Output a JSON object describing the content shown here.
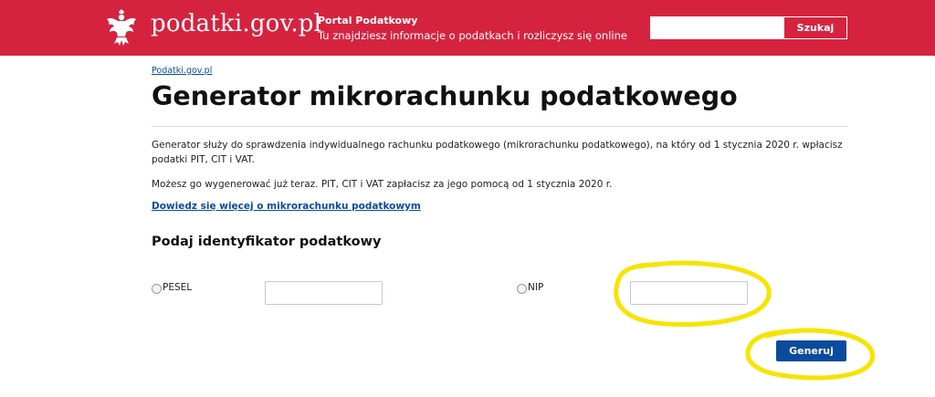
{
  "header": {
    "brand": "podatki.gov.pl",
    "portal_title": "Portal Podatkowy",
    "portal_subtitle": "Tu znajdziesz informacje o podatkach i rozliczysz się online",
    "search_value": "",
    "search_button": "Szukaj",
    "logo_icon": "white-eagle-emblem-icon"
  },
  "breadcrumb": "Podatki.gov.pl",
  "page_title": "Generator mikrorachunku podatkowego",
  "intro": {
    "paragraph1": "Generator służy do sprawdzenia indywidualnego rachunku podatkowego (mikrorachunku podatkowego), na który od 1 stycznia 2020 r. wpłacisz podatki PIT, CIT i VAT.",
    "paragraph2": "Możesz go wygenerować już teraz. PIT, CIT i VAT zapłacisz za jego pomocą od 1 stycznia 2020 r.",
    "link": "Dowiedz się więcej o mikrorachunku podatkowym"
  },
  "form": {
    "section_title": "Podaj identyfikator podatkowy",
    "pesel_label": "PESEL",
    "pesel_value": "",
    "nip_label": "NIP",
    "nip_value": "",
    "submit_label": "Generuj"
  },
  "colors": {
    "header_red": "#d5233f",
    "link_blue": "#0b4b9e",
    "annotation_yellow": "#f5e400"
  }
}
